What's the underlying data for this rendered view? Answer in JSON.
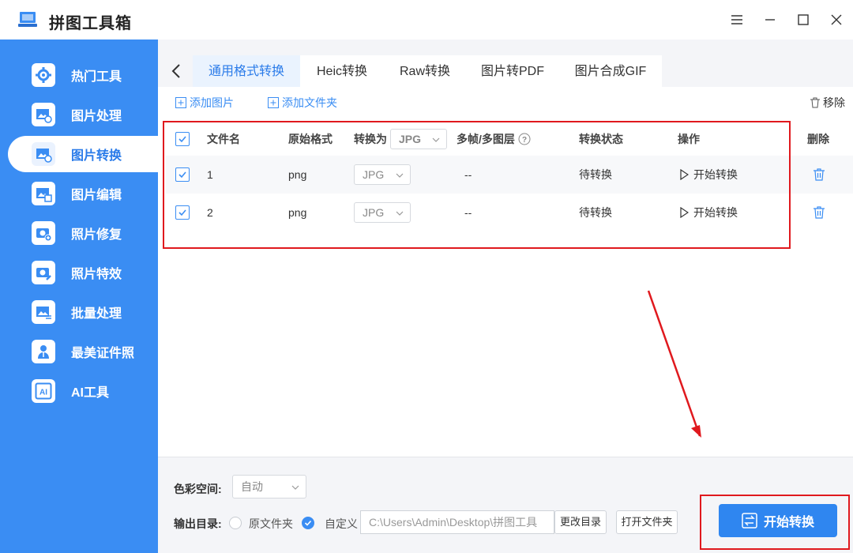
{
  "app": {
    "title": "拼图工具箱"
  },
  "sidebar": {
    "items": [
      {
        "label": "热门工具",
        "icon": "gear-icon"
      },
      {
        "label": "图片处理",
        "icon": "image-clock-icon"
      },
      {
        "label": "图片转换",
        "icon": "image-convert-icon"
      },
      {
        "label": "图片编辑",
        "icon": "image-edit-icon"
      },
      {
        "label": "照片修复",
        "icon": "camera-plus-icon"
      },
      {
        "label": "照片特效",
        "icon": "camera-magic-icon"
      },
      {
        "label": "批量处理",
        "icon": "image-batch-icon"
      },
      {
        "label": "最美证件照",
        "icon": "id-photo-icon"
      },
      {
        "label": "AI工具",
        "icon": "ai-icon"
      }
    ],
    "active_index": 2
  },
  "tabs": [
    {
      "label": "通用格式转换"
    },
    {
      "label": "Heic转换"
    },
    {
      "label": "Raw转换"
    },
    {
      "label": "图片转PDF"
    },
    {
      "label": "图片合成GIF"
    }
  ],
  "toolbar": {
    "add_image": "添加图片",
    "add_folder": "添加文件夹",
    "remove": "移除"
  },
  "table": {
    "headers": {
      "filename": "文件名",
      "original_format": "原始格式",
      "convert_to": "转换为",
      "convert_to_value": "JPG",
      "multi_frame": "多帧/多图层",
      "status": "转换状态",
      "action": "操作",
      "delete": "删除"
    },
    "rows": [
      {
        "name": "1",
        "format": "png",
        "target": "JPG",
        "frames": "--",
        "status": "待转换",
        "action": "开始转换"
      },
      {
        "name": "2",
        "format": "png",
        "target": "JPG",
        "frames": "--",
        "status": "待转换",
        "action": "开始转换"
      }
    ]
  },
  "bottom": {
    "color_space_label": "色彩空间:",
    "color_space_value": "自动",
    "output_label": "输出目录:",
    "option_original": "原文件夹",
    "option_custom": "自定义",
    "output_path": "C:\\Users\\Admin\\Desktop\\拼图工具",
    "change_dir": "更改目录",
    "open_folder": "打开文件夹",
    "start": "开始转换"
  },
  "colors": {
    "brand": "#3a8df3",
    "annotation": "#e0191e"
  }
}
